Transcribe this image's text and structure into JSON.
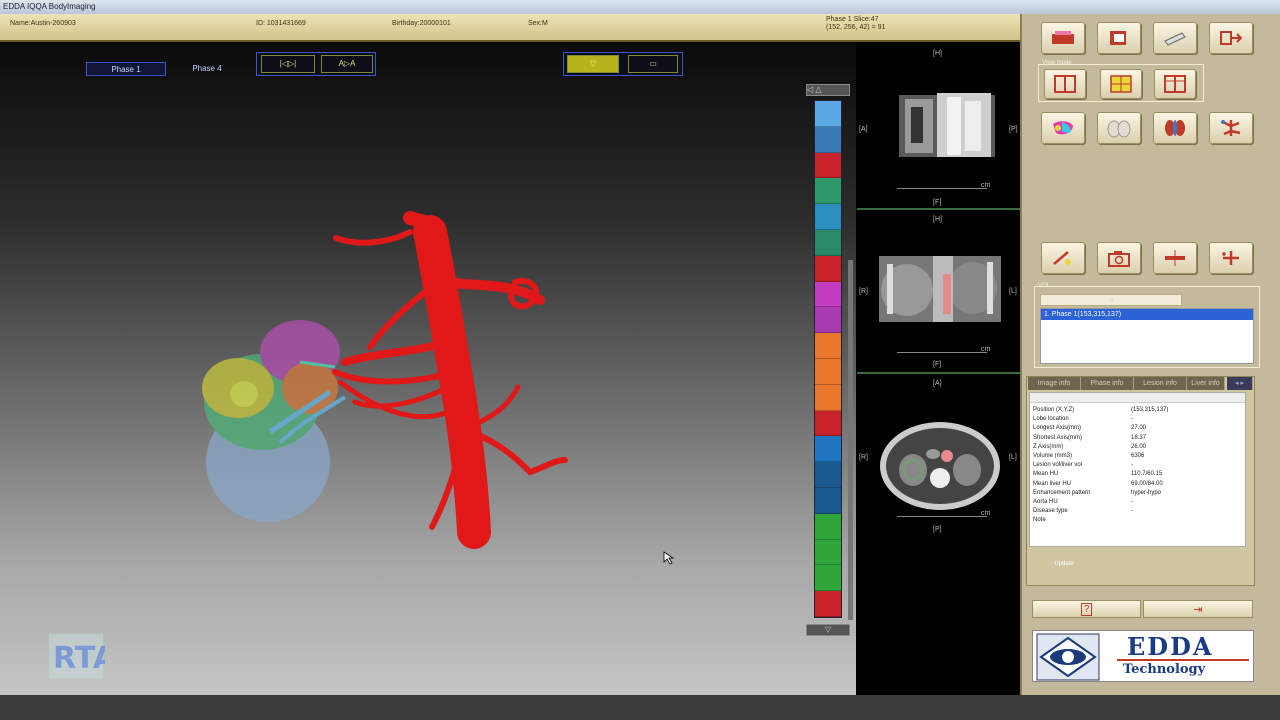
{
  "window": {
    "title": "EDDA IQQA BodyImaging"
  },
  "patient": {
    "name": "Name:Austin-260903",
    "id": "ID: 1031431669",
    "birthday": "Birthday:20000101",
    "sex": "Sex:M",
    "phase_line": "Phase 1   Slice:47",
    "position_line": "(152, 256, 42) = 91"
  },
  "viewer": {
    "phase_tabs": [
      {
        "label": "Phase 1"
      },
      {
        "label": "Phase 4"
      }
    ],
    "tools": [
      {
        "label": "|◁▷|"
      },
      {
        "label": "A▷A"
      },
      {
        "label": "▽"
      },
      {
        "label": "▭"
      }
    ],
    "strip_colors": [
      "#5aa8e6",
      "#3a7ab4",
      "#c8232a",
      "#2c9a6a",
      "#2b8fc0",
      "#2a8a66",
      "#c8232a",
      "#c23dc2",
      "#a83ab0",
      "#e8772a",
      "#e8772a",
      "#e8772a",
      "#c8232a",
      "#1f77c2",
      "#1b5a8f",
      "#1b5a8f",
      "#2ea63a",
      "#2ea63a",
      "#2ea63a",
      "#c8232a"
    ],
    "up_arrow": "◁ △",
    "down_arrow": "▽"
  },
  "mpr": {
    "labels": {
      "v1_top": "[H]",
      "v1_left": "[A]",
      "v1_right": "[P]",
      "v1_bottom": "[F]",
      "v1_cm": "cm",
      "v2_top": "[H]",
      "v2_left": "[R]",
      "v2_right": "[L]",
      "v2_bottom": "[F]",
      "v2_cm": "cm",
      "v3_top": "[A]",
      "v3_left": "[R]",
      "v3_right": "[L]",
      "v3_bottom": "[P]",
      "v3_cm": "cm"
    }
  },
  "panel": {
    "view_mode_label": "View mode",
    "voi_label": "VOI",
    "voi_item": "1. Phase 1(153,315,137)",
    "tabs": [
      "Image info",
      "Phase info",
      "Lesion info",
      "Liver info"
    ],
    "rows": [
      {
        "key": "Position (X,Y,Z)",
        "value": "(153,315,137)"
      },
      {
        "key": "Lobe location",
        "value": "-"
      },
      {
        "key": "Longest Axis(mm)",
        "value": "27.00"
      },
      {
        "key": "Shortest Axis(mm)",
        "value": "18.37"
      },
      {
        "key": "Z Axis(mm)",
        "value": "26.00"
      },
      {
        "key": "Volume (mm3)",
        "value": "6306"
      },
      {
        "key": "Lesion vol/liver vol",
        "value": "-"
      },
      {
        "key": "Mean HU",
        "value": "110.7/60.15"
      },
      {
        "key": "Mean liver HU",
        "value": "69.00/84.00"
      },
      {
        "key": "Enhancement pattern",
        "value": "hyper-hypo"
      },
      {
        "key": "Aorta HU",
        "value": "-"
      },
      {
        "key": "Disease type",
        "value": "-"
      },
      {
        "key": "Note",
        "value": ""
      }
    ],
    "update_label": "Update",
    "help_label": "?",
    "exit_label": "⇥"
  },
  "logos": {
    "edda_line1": "EDDA",
    "edda_line2": "Technology"
  }
}
